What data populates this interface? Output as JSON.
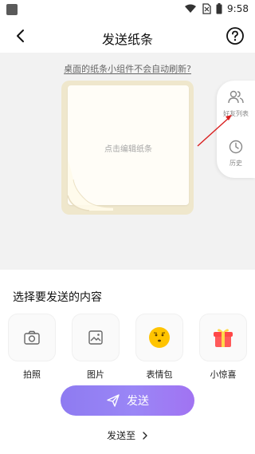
{
  "status": {
    "time": "9:58"
  },
  "header": {
    "title": "发送纸条"
  },
  "tip": {
    "text": "桌面的纸条小组件不会自动刷新?"
  },
  "note": {
    "hint": "点击编辑纸条"
  },
  "side": {
    "friends_label": "好友列表",
    "history_label": "历史"
  },
  "compose": {
    "section_title": "选择要发送的内容",
    "options": [
      {
        "label": "拍照",
        "icon": "camera-icon"
      },
      {
        "label": "图片",
        "icon": "image-icon"
      },
      {
        "label": "表情包",
        "icon": "emoji-icon"
      },
      {
        "label": "小惊喜",
        "icon": "gift-icon"
      }
    ],
    "send_label": "发送",
    "send_to_label": "发送至"
  },
  "colors": {
    "accent": "#9a86f6",
    "note_card": "#efe7cc",
    "arrow": "#d92020"
  }
}
